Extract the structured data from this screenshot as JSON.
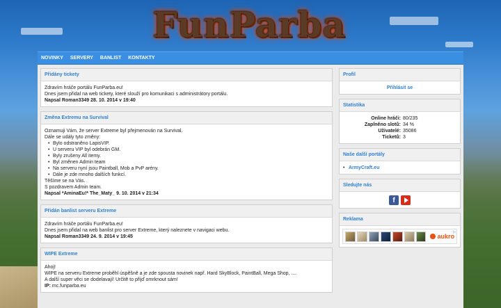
{
  "logo": {
    "text": "FunParba"
  },
  "nav": [
    {
      "label": "NOVINKY"
    },
    {
      "label": "SERVERY"
    },
    {
      "label": "BANLIST"
    },
    {
      "label": "KONTAKTY"
    }
  ],
  "posts": [
    {
      "title": "Přidány tickety",
      "lines": [
        "Zdravím hráče portálu FunParba.eu!",
        "Dnes jsem přidal na web tickety, které slouží pro komunikaci s administrátory portálu."
      ],
      "list": [],
      "after": [],
      "author": "Napsal Roman3349 28. 10. 2014 v 19:40"
    },
    {
      "title": "Změna Extremu na Survival",
      "lines": [
        "Oznamuji Vám, že server Extreme byl přejmenován na Survival.",
        "Dále se udály tyto změny:"
      ],
      "list": [
        "Bylo odstraněno LapisVIP.",
        "U serveru VIP byl odebrán GM.",
        "Byly zrušeny All itemy.",
        "Byl změnen Admin team",
        "Na serveru nyní jsou Paintball, Mob a PvP arény.",
        "Dále je zde mnoho dalších funkcí."
      ],
      "after": [
        "Těšíme se na Vás.",
        "S pozdravem Admin team."
      ],
      "author": "Napsal *AminaEu!* The_Maty_ 9. 10. 2014 v 21:34"
    },
    {
      "title": "Přidán banlist serveru Extreme",
      "lines": [
        "Zdravím hráče portálu FunParba.eu!",
        "Dnes jsem přidal na web banlist pro server Extreme, který naleznete v navigaci webu."
      ],
      "list": [],
      "after": [],
      "author": "Napsal Roman3349 24. 9. 2014 v 19:45"
    },
    {
      "title": "WIPE Extreme",
      "lines": [
        "Ahoj!",
        "WIPE na serveru Extreme proběhl úspěšně a je zde spousta novinek např. Hard SkyBlock, PaintBall, Mega Shop, ....",
        "A další super věci se dodelavají! Určitě to přijď omrknout sám!"
      ],
      "list": [],
      "after": [],
      "ip_label": "IP:",
      "ip_value": "mc.funparba.eu"
    }
  ],
  "sidebar": {
    "profile": {
      "title": "Profil",
      "login": "Přihlásit se"
    },
    "stats": {
      "title": "Statistika",
      "rows": [
        {
          "k": "Online hráči:",
          "v": "80/235"
        },
        {
          "k": "Zaplněno slotů:",
          "v": "34 %"
        },
        {
          "k": "Uživatelé:",
          "v": "35086"
        },
        {
          "k": "Ticketů:",
          "v": "3"
        }
      ]
    },
    "portals": {
      "title": "Naše další portály",
      "items": [
        "ArmyCraft.eu"
      ]
    },
    "follow": {
      "title": "Sledujte nás",
      "fb_letter": "f"
    },
    "ads": {
      "title": "Reklama",
      "brand": "aukro"
    }
  }
}
